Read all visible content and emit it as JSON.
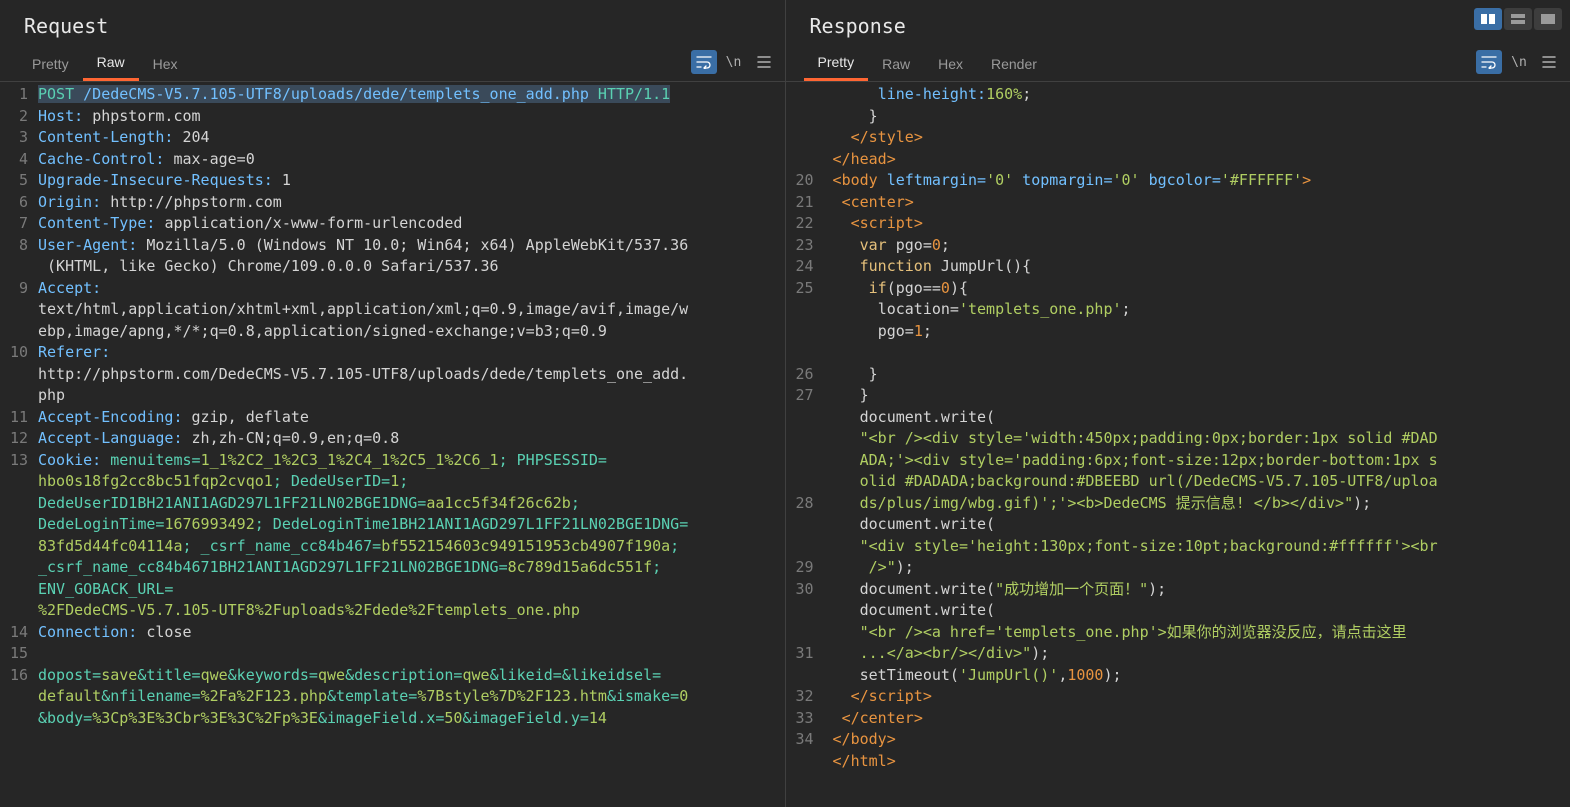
{
  "request": {
    "title": "Request",
    "tabs": {
      "pretty": "Pretty",
      "raw": "Raw",
      "hex": "Hex",
      "active": "raw"
    },
    "tools": {
      "newline": "\\n"
    },
    "gutter": [
      "1",
      "2",
      "3",
      "4",
      "5",
      "6",
      "7",
      "8",
      "",
      "9",
      "",
      "",
      "10",
      "",
      "",
      "11",
      "12",
      "13",
      "",
      "",
      "",
      "",
      "",
      "",
      "",
      "14",
      "15",
      "16",
      "",
      ""
    ],
    "h": {
      "method": "POST",
      "path": "/DedeCMS-V5.7.105-UTF8/uploads/dede/templets_one_add.php",
      "proto": "HTTP/1.1",
      "host_k": "Host:",
      "host_v": "phpstorm.com",
      "cl_k": "Content-Length:",
      "cl_v": "204",
      "cc_k": "Cache-Control:",
      "cc_v": "max-age=0",
      "uir_k": "Upgrade-Insecure-Requests:",
      "uir_v": "1",
      "org_k": "Origin:",
      "org_v": "http://phpstorm.com",
      "ct_k": "Content-Type:",
      "ct_v": "application/x-www-form-urlencoded",
      "ua_k": "User-Agent:",
      "ua_v1": "Mozilla/5.0 (Windows NT 10.0; Win64; x64) AppleWebKit/537.36",
      "ua_v2": " (KHTML, like Gecko) Chrome/109.0.0.0 Safari/537.36",
      "acc_k": "Accept:",
      "acc_v1": "text/html,application/xhtml+xml,application/xml;q=0.9,image/avif,image/w",
      "acc_v2": "ebp,image/apng,*/*;q=0.8,application/signed-exchange;v=b3;q=0.9",
      "ref_k": "Referer:",
      "ref_v1": "http://phpstorm.com/DedeCMS-V5.7.105-UTF8/uploads/dede/templets_one_add.",
      "ref_v2": "php",
      "ae_k": "Accept-Encoding:",
      "ae_v": "gzip, deflate",
      "al_k": "Accept-Language:",
      "al_v": "zh,zh-CN;q=0.9,en;q=0.8",
      "ck_k": "Cookie:",
      "ck_menu_k": "menuitems=",
      "ck_menu_v": "1_1%2C2_1%2C3_1%2C4_1%2C5_1%2C6_1",
      "ck_sess_k": "; PHPSESSID=",
      "ck_sess_v": "hbo0s18fg2cc8bc51fqp2cvqo1",
      "ck_uid_k": "; DedeUserID=",
      "ck_uid_v": "1",
      "ck_semi": ";",
      "ck_uidbh_k": "DedeUserID1BH21ANI1AGD297L1FF21LN02BGE1DNG=",
      "ck_uidbh_v": "aa1cc5f34f26c62b",
      "ck_semi2": ";",
      "ck_lt_k": "DedeLoginTime=",
      "ck_lt_v": "1676993492",
      "ck_ltbh_k": "; DedeLoginTime1BH21ANI1AGD297L1FF21LN02BGE1DNG=",
      "ck_ltbh_v": "83fd5d44fc04114a",
      "ck_csrf_k": "; _csrf_name_cc84b467=",
      "ck_csrf_v": "bf552154603c949151953cb4907f190a",
      "ck_semi3": ";",
      "ck_csrf2_k": "_csrf_name_cc84b4671BH21ANI1AGD297L1FF21LN02BGE1DNG=",
      "ck_csrf2_v": "8c789d15a6dc551f",
      "ck_semi4": ";",
      "ck_env_k": "ENV_GOBACK_URL=",
      "ck_env_v": "%2FDedeCMS-V5.7.105-UTF8%2Fuploads%2Fdede%2Ftemplets_one.php",
      "conn_k": "Connection:",
      "conn_v": "close"
    },
    "body": {
      "dopost_k": "dopost=",
      "dopost_v": "save",
      "amp1": "&title=",
      "title_v": "qwe",
      "amp2": "&keywords=",
      "kw_v": "qwe",
      "amp3": "&description=",
      "desc_v": "qwe",
      "amp4": "&likeid=",
      "amp5": "&likeidsel=",
      "likeidsel_v": "default",
      "amp6": "&nfilename=",
      "nfile_v": "%2Fa%2F123.php",
      "amp7": "&template=",
      "tpl_v": "%7Bstyle%7D%2F123.htm",
      "amp8": "&ismake=",
      "ismake_v": "0",
      "amp9": "&body=",
      "body_v": "%3Cp%3E%3Cbr%3E%3C%2Fp%3E",
      "amp10": "&imageField.x=",
      "ifx_v": "50",
      "amp11": "&imageField.y=",
      "ify_v": "14"
    }
  },
  "response": {
    "title": "Response",
    "tabs": {
      "pretty": "Pretty",
      "raw": "Raw",
      "hex": "Hex",
      "render": "Render",
      "active": "pretty"
    },
    "gutter": [
      "",
      "",
      "",
      "",
      "20",
      "21",
      "22",
      "23",
      "24",
      "25",
      "",
      "",
      "",
      "26",
      "27",
      "",
      "",
      "",
      "",
      "28",
      "",
      "",
      "29",
      "30",
      "",
      "",
      "31",
      "",
      "32",
      "33",
      "34",
      ""
    ],
    "lines": {
      "l1a": "line-height:",
      "l1b": "160%",
      "l1c": ";",
      "l2": "}",
      "l3a": "</",
      "l3b": "style",
      "l3c": ">",
      "l4a": "</",
      "l4b": "head",
      "l4c": ">",
      "l5a": "<",
      "l5b": "body",
      "l5c": " leftmargin=",
      "l5d": "'0'",
      "l5e": " topmargin=",
      "l5f": "'0'",
      "l5g": " bgcolor=",
      "l5h": "'#FFFFFF'",
      "l5i": ">",
      "l6a": "<",
      "l6b": "center",
      "l6c": ">",
      "l7a": "<",
      "l7b": "script",
      "l7c": ">",
      "l8a": "var",
      "l8b": " pgo=",
      "l8c": "0",
      "l8d": ";",
      "l9a": "function",
      "l9b": " JumpUrl(){",
      "l10a": "if",
      "l10b": "(pgo==",
      "l10c": "0",
      "l10d": "){",
      "l11a": "location=",
      "l11b": "'templets_one.php'",
      "l11c": ";",
      "l12a": "pgo=",
      "l12b": "1",
      "l12c": ";",
      "l13": "}",
      "l14": "}",
      "l15a": "document.write(",
      "l16": "\"<br /><div style='width:450px;padding:0px;border:1px solid #DAD",
      "l17": "ADA;'><div style='padding:6px;font-size:12px;border-bottom:1px s",
      "l18": "olid #DADADA;background:#DBEEBD url(/DedeCMS-V5.7.105-UTF8/uploa",
      "l19a": "ds/plus/img/wbg.gif)';'><b>DedeCMS 提示信息! </b></div>\"",
      "l19b": ");",
      "l20a": "document.write(",
      "l21": "\"<div style='height:130px;font-size:10pt;background:#ffffff'><br",
      "l22a": " />\"",
      "l22b": ");",
      "l23a": "document.write(",
      "l23b": "\"成功增加一个页面！\"",
      "l23c": ");",
      "l24a": "document.write(",
      "l25": "\"<br /><a href='templets_one.php'>如果你的浏览器没反应，请点击这里",
      "l26a": "...</a><br/></div>\"",
      "l26b": ");",
      "l27a": "setTimeout(",
      "l27b": "'JumpUrl()'",
      "l27c": ",",
      "l27d": "1000",
      "l27e": ");",
      "l28a": "</",
      "l28b": "script",
      "l28c": ">",
      "l29a": "</",
      "l29b": "center",
      "l29c": ">",
      "l30a": "</",
      "l30b": "body",
      "l30c": ">",
      "l31a": "</",
      "l31b": "html",
      "l31c": ">"
    }
  }
}
